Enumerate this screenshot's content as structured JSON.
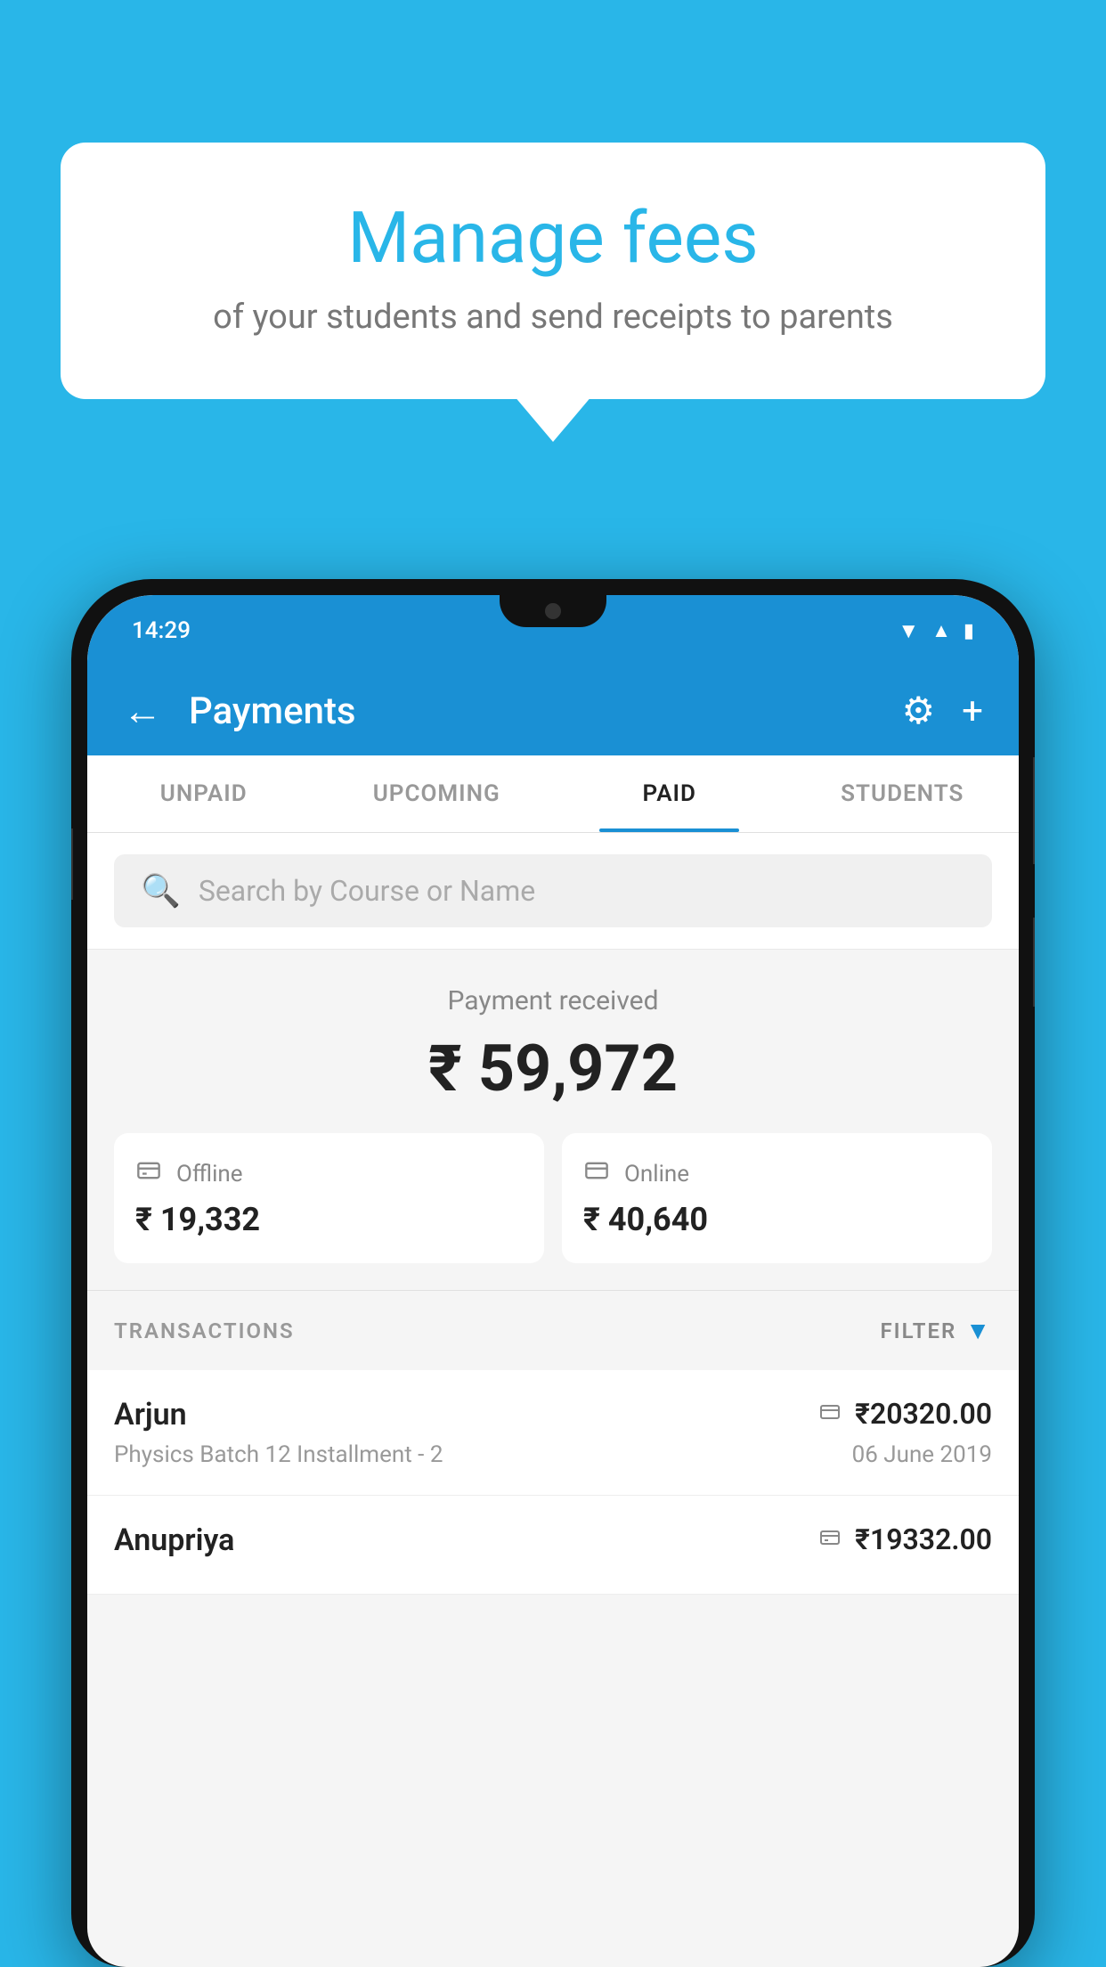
{
  "background_color": "#29b6e8",
  "bubble": {
    "title": "Manage fees",
    "subtitle": "of your students and send receipts to parents"
  },
  "status_bar": {
    "time": "14:29"
  },
  "app_bar": {
    "title": "Payments",
    "back_label": "←",
    "gear_label": "⚙",
    "plus_label": "+"
  },
  "tabs": [
    {
      "label": "UNPAID",
      "active": false
    },
    {
      "label": "UPCOMING",
      "active": false
    },
    {
      "label": "PAID",
      "active": true
    },
    {
      "label": "STUDENTS",
      "active": false
    }
  ],
  "search": {
    "placeholder": "Search by Course or Name"
  },
  "payment_summary": {
    "label": "Payment received",
    "total": "₹ 59,972",
    "offline": {
      "icon": "💳",
      "label": "Offline",
      "amount": "₹ 19,332"
    },
    "online": {
      "icon": "💳",
      "label": "Online",
      "amount": "₹ 40,640"
    }
  },
  "transactions": {
    "label": "TRANSACTIONS",
    "filter_label": "FILTER",
    "items": [
      {
        "name": "Arjun",
        "payment_type": "online",
        "amount": "₹20320.00",
        "course": "Physics Batch 12 Installment - 2",
        "date": "06 June 2019"
      },
      {
        "name": "Anupriya",
        "payment_type": "offline",
        "amount": "₹19332.00",
        "course": "",
        "date": ""
      }
    ]
  }
}
